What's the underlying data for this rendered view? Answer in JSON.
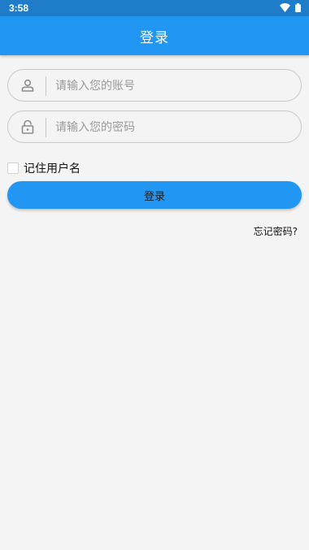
{
  "status_bar": {
    "time": "3:58",
    "icons": [
      "wifi-icon",
      "battery-icon"
    ]
  },
  "app_bar": {
    "title": "登录"
  },
  "form": {
    "account": {
      "placeholder": "请输入您的账号",
      "value": "",
      "icon": "user-icon"
    },
    "password": {
      "placeholder": "请输入您的密码",
      "value": "",
      "icon": "lock-icon"
    },
    "remember_label": "记住用户名",
    "remember_checked": false,
    "login_label": "登录",
    "forgot_label": "忘记密码?"
  },
  "colors": {
    "primary": "#2296f3",
    "status_bar": "#1e7cc9",
    "background": "#f4f4f4"
  }
}
